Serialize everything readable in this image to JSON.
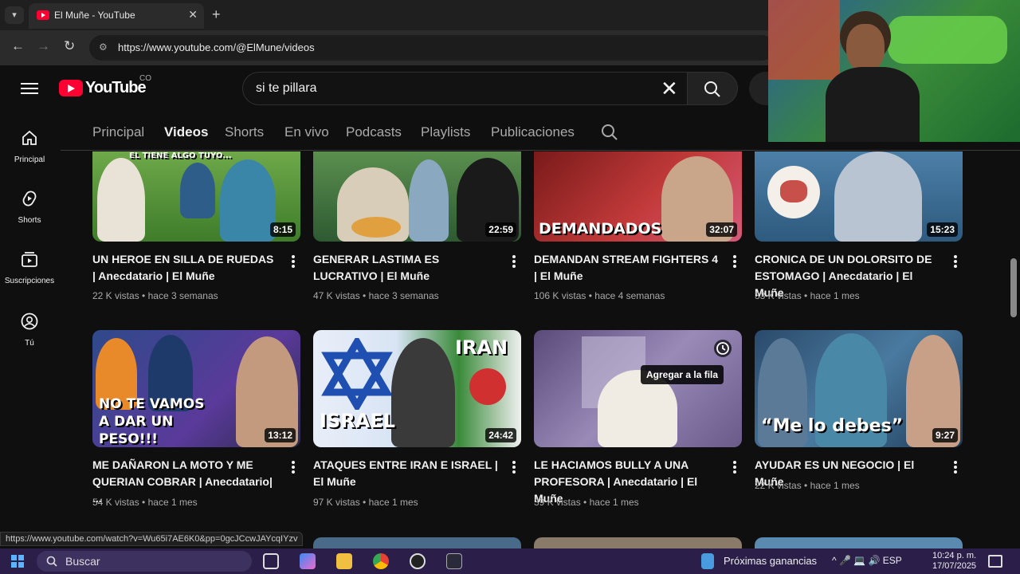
{
  "browser": {
    "tab_title": "El Muñe - YouTube",
    "tab_close": "✕",
    "new_tab": "+",
    "url": "https://www.youtube.com/@ElMune/videos",
    "back": "←",
    "forward": "→",
    "reload": "↻"
  },
  "masthead": {
    "wordmark": "YouTube",
    "country": "CO",
    "search_value": "si te pillara",
    "clear": "✕"
  },
  "sidebar": [
    {
      "label": "Principal",
      "icon": "home-icon"
    },
    {
      "label": "Shorts",
      "icon": "shorts-icon"
    },
    {
      "label": "Suscripciones",
      "icon": "subscriptions-icon"
    },
    {
      "label": "Tú",
      "icon": "you-icon"
    }
  ],
  "channel_tabs": [
    "Principal",
    "Videos",
    "Shorts",
    "En vivo",
    "Podcasts",
    "Playlists",
    "Publicaciones"
  ],
  "active_tab": "Videos",
  "videos": [
    {
      "title": "UN HEROE EN SILLA DE RUEDAS | Anecdatario | El Muñe",
      "views": "22 K vistas",
      "age": "hace 3 semanas",
      "duration": "8:15",
      "overlay": "EL TIENE ALGO TUYO..."
    },
    {
      "title": "GENERAR LASTIMA ES LUCRATIVO | El Muñe",
      "views": "47 K vistas",
      "age": "hace 3 semanas",
      "duration": "22:59",
      "overlay": ""
    },
    {
      "title": "DEMANDAN STREAM FIGHTERS 4 | El Muñe",
      "views": "106 K vistas",
      "age": "hace 4 semanas",
      "duration": "32:07",
      "overlay": "DEMANDADOS"
    },
    {
      "title": "CRONICA DE UN DOLORSITO DE ESTOMAGO | Anecdatario | El Muñe",
      "views": "33 K vistas",
      "age": "hace 1 mes",
      "duration": "15:23",
      "overlay": ""
    },
    {
      "title": "ME DAÑARON LA MOTO Y ME QUERIAN COBRAR | Anecdatario| ...",
      "views": "54 K vistas",
      "age": "hace 1 mes",
      "duration": "13:12",
      "overlay": "NO TE VAMOS A DAR UN PESO!!!"
    },
    {
      "title": "ATAQUES ENTRE IRAN E ISRAEL | El Muñe",
      "views": "97 K vistas",
      "age": "hace 1 mes",
      "duration": "24:42",
      "overlay": "ISRAEL",
      "overlay2": "IRAN"
    },
    {
      "title": "LE HACIAMOS BULLY A UNA PROFESORA | Anecdatario | El Muñe",
      "views": "39 K vistas",
      "age": "hace 1 mes",
      "duration": "",
      "overlay": ""
    },
    {
      "title": "AYUDAR ES UN NEGOCIO | El Muñe",
      "views": "22 K vistas",
      "age": "hace 1 mes",
      "duration": "9:27",
      "overlay": "“Me lo debes”"
    }
  ],
  "tooltip": "Agregar a la fila",
  "meta_sep": "•",
  "status_url": "https://www.youtube.com/watch?v=Wu65i7AE6K0&pp=0gcJCcwJAYcqIYzv",
  "taskbar": {
    "search": "Buscar",
    "weather": "Próximas ganancias",
    "lang": "ESP",
    "time": "10:24 p. m.",
    "date": "17/07/2025"
  },
  "colors": {
    "accent": "#ff0033",
    "bg": "#0f0f0f",
    "taskbar": "#2b1f4a"
  }
}
